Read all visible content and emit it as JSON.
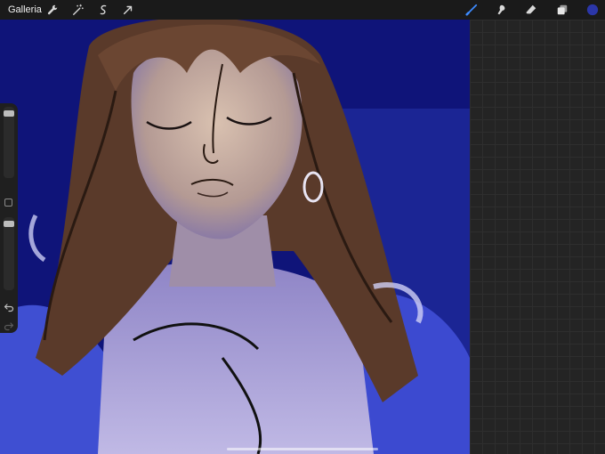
{
  "toolbar": {
    "gallery_label": "Galleria",
    "left_tools": [
      "wrench-icon",
      "magic-wand-icon",
      "selection-icon",
      "transform-arrow-icon"
    ],
    "right_tools": [
      "brush-icon",
      "smudge-icon",
      "eraser-icon",
      "layers-icon"
    ],
    "current_color": "#2b36a8",
    "active_tool_color": "#3d8bff"
  },
  "sidebar": {
    "brush_size_fraction": 0.05,
    "opacity_fraction": 0.05
  },
  "colors": {
    "canvas_background": "#0f1479",
    "toolbar_background": "#1a1a1a"
  }
}
